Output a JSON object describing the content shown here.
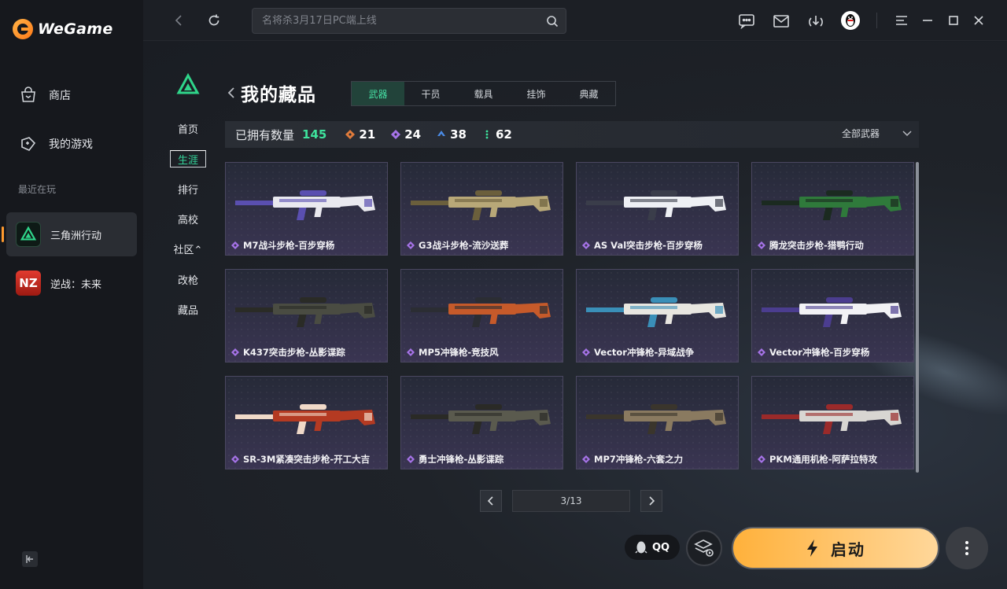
{
  "app": {
    "brand": "WeGame",
    "colors": {
      "accent": "#ff9a2e",
      "green": "#3ee29c",
      "launch": "#ffb13b"
    }
  },
  "sidebar": {
    "nav": [
      {
        "label": "商店",
        "icon": "shopping-bag-icon"
      },
      {
        "label": "我的游戏",
        "icon": "gamepad-icon"
      }
    ],
    "recent_label": "最近在玩",
    "games": [
      {
        "label": "三角洲行动",
        "icon": "delta-force-icon"
      },
      {
        "label": "逆战：未来",
        "icon": "nizhan-icon",
        "icon_text": "NZ"
      }
    ]
  },
  "topbar": {
    "search_placeholder": "名将杀3月17日PC端上线"
  },
  "game_nav": {
    "items": [
      "首页",
      "生涯",
      "排行",
      "高校",
      "社区⌃",
      "改枪",
      "藏品"
    ],
    "active": "生涯"
  },
  "collection": {
    "title": "我的藏品",
    "tabs": [
      "武器",
      "干员",
      "载具",
      "挂饰",
      "典藏"
    ],
    "active_tab": "武器",
    "owned_label": "已拥有数量",
    "owned_total": "145",
    "rarity_counts": [
      {
        "value": "21",
        "color": "#e07b3b"
      },
      {
        "value": "24",
        "color": "#a673e8"
      },
      {
        "value": "38",
        "color": "#4a8be6"
      },
      {
        "value": "62",
        "color": "#3ee29c"
      }
    ],
    "filter_label": "全部武器",
    "items": [
      {
        "name": "M7战斗步枪-百步穿杨",
        "palette": [
          "#e9e9ef",
          "#5a4fb0"
        ]
      },
      {
        "name": "G3战斗步枪-流沙送葬",
        "palette": [
          "#b8a878",
          "#6b5f3c"
        ]
      },
      {
        "name": "AS Val突击步枪-百步穿杨",
        "palette": [
          "#eef0f4",
          "#3a3d4a"
        ]
      },
      {
        "name": "腾龙突击步枪-猎鹗行动",
        "palette": [
          "#2f7a3b",
          "#1b2a20"
        ]
      },
      {
        "name": "K437突击步枪-丛影谍踪",
        "palette": [
          "#4a4c42",
          "#2a2b26"
        ]
      },
      {
        "name": "MP5冲锋枪-竞技风",
        "palette": [
          "#c65a2a",
          "#2b2d33"
        ]
      },
      {
        "name": "Vector冲锋枪-异域战争",
        "palette": [
          "#e8e6e0",
          "#3a8fb8"
        ]
      },
      {
        "name": "Vector冲锋枪-百步穿杨",
        "palette": [
          "#f2f2f5",
          "#4b3d8f"
        ]
      },
      {
        "name": "SR-3M紧凑突击步枪-开工大吉",
        "palette": [
          "#b43a22",
          "#f0d9c8"
        ]
      },
      {
        "name": "勇士冲锋枪-丛影谍踪",
        "palette": [
          "#5a5a4e",
          "#2a2a26"
        ]
      },
      {
        "name": "MP7冲锋枪-六套之力",
        "palette": [
          "#8a7a60",
          "#3a352c"
        ]
      },
      {
        "name": "PKM通用机枪-阿萨拉特攻",
        "palette": [
          "#d8d6d2",
          "#9a2a2a"
        ]
      }
    ],
    "pager": "3/13"
  },
  "footer": {
    "qq_label": "QQ",
    "launch_label": "启动"
  }
}
